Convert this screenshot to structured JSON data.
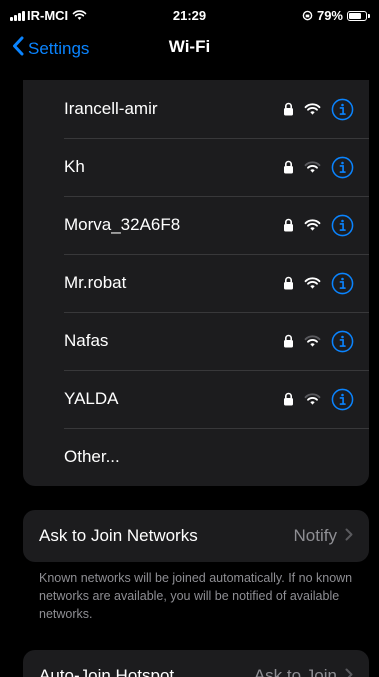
{
  "status_bar": {
    "carrier": "IR-MCI",
    "time": "21:29",
    "battery_percent_text": "79%",
    "battery_level": 0.79
  },
  "nav": {
    "back_label": "Settings",
    "title": "Wi-Fi"
  },
  "networks": [
    {
      "name": "Irancell-amir",
      "secured": true,
      "signal_bars": 3
    },
    {
      "name": "Kh",
      "secured": true,
      "signal_bars": 2
    },
    {
      "name": "Morva_32A6F8",
      "secured": true,
      "signal_bars": 3
    },
    {
      "name": "Mr.robat",
      "secured": true,
      "signal_bars": 3
    },
    {
      "name": "Nafas",
      "secured": true,
      "signal_bars": 2
    },
    {
      "name": "YALDA",
      "secured": true,
      "signal_bars": 2
    }
  ],
  "other_label": "Other...",
  "ask_to_join": {
    "label": "Ask to Join Networks",
    "value": "Notify",
    "footer": "Known networks will be joined automatically. If no known networks are available, you will be notified of available networks."
  },
  "auto_join_hotspot": {
    "label": "Auto-Join Hotspot",
    "value": "Ask to Join"
  },
  "colors": {
    "accent": "#0a84ff",
    "background": "#000000",
    "group_background": "#1c1c1e",
    "secondary_text": "#8e8e93"
  },
  "icons": {
    "secured": "lock-icon",
    "signal": "wifi-icon",
    "details": "info-icon",
    "back": "chevron-left-icon",
    "disclosure": "chevron-right-icon"
  }
}
